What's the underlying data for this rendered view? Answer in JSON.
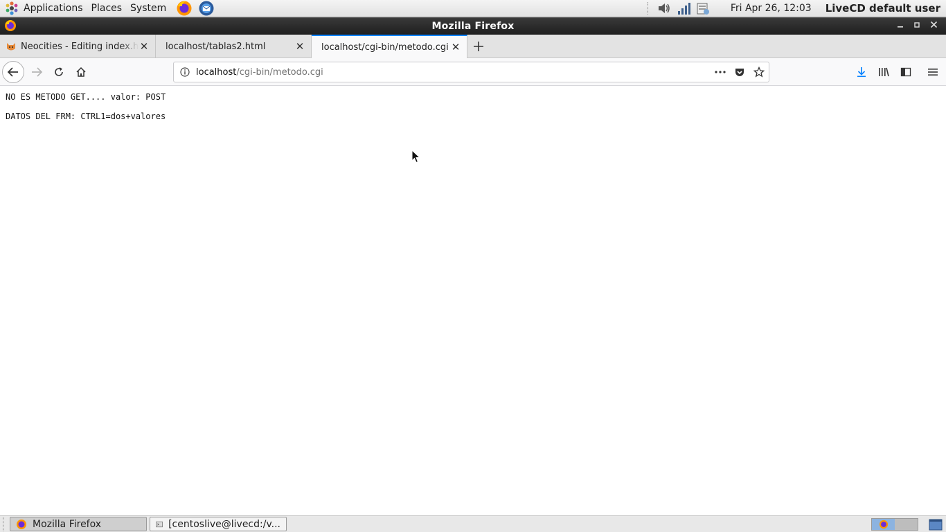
{
  "panel": {
    "menus": [
      "Applications",
      "Places",
      "System"
    ],
    "clock": "Fri Apr 26, 12:03",
    "user": "LiveCD default user"
  },
  "window": {
    "title": "Mozilla Firefox"
  },
  "tabs": [
    {
      "label": "Neocities - Editing index.html",
      "icon": "neocities-cat-icon",
      "active": false
    },
    {
      "label": "localhost/tablas2.html",
      "icon": "",
      "active": false
    },
    {
      "label": "localhost/cgi-bin/metodo.cgi",
      "icon": "",
      "active": true
    }
  ],
  "url": {
    "host": "localhost",
    "path": "/cgi-bin/metodo.cgi"
  },
  "page": {
    "line1": "NO ES METODO GET.... valor: POST",
    "line2": "DATOS DEL FRM: CTRL1=dos+valores"
  },
  "taskbar": {
    "items": [
      {
        "label": "Mozilla Firefox",
        "active": true
      },
      {
        "label": "[centoslive@livecd:/v...",
        "active": false
      }
    ]
  },
  "colors": {
    "accent": "#0a84ff",
    "titlebar": "#2b2b2b",
    "panel": "#ebebeb"
  }
}
